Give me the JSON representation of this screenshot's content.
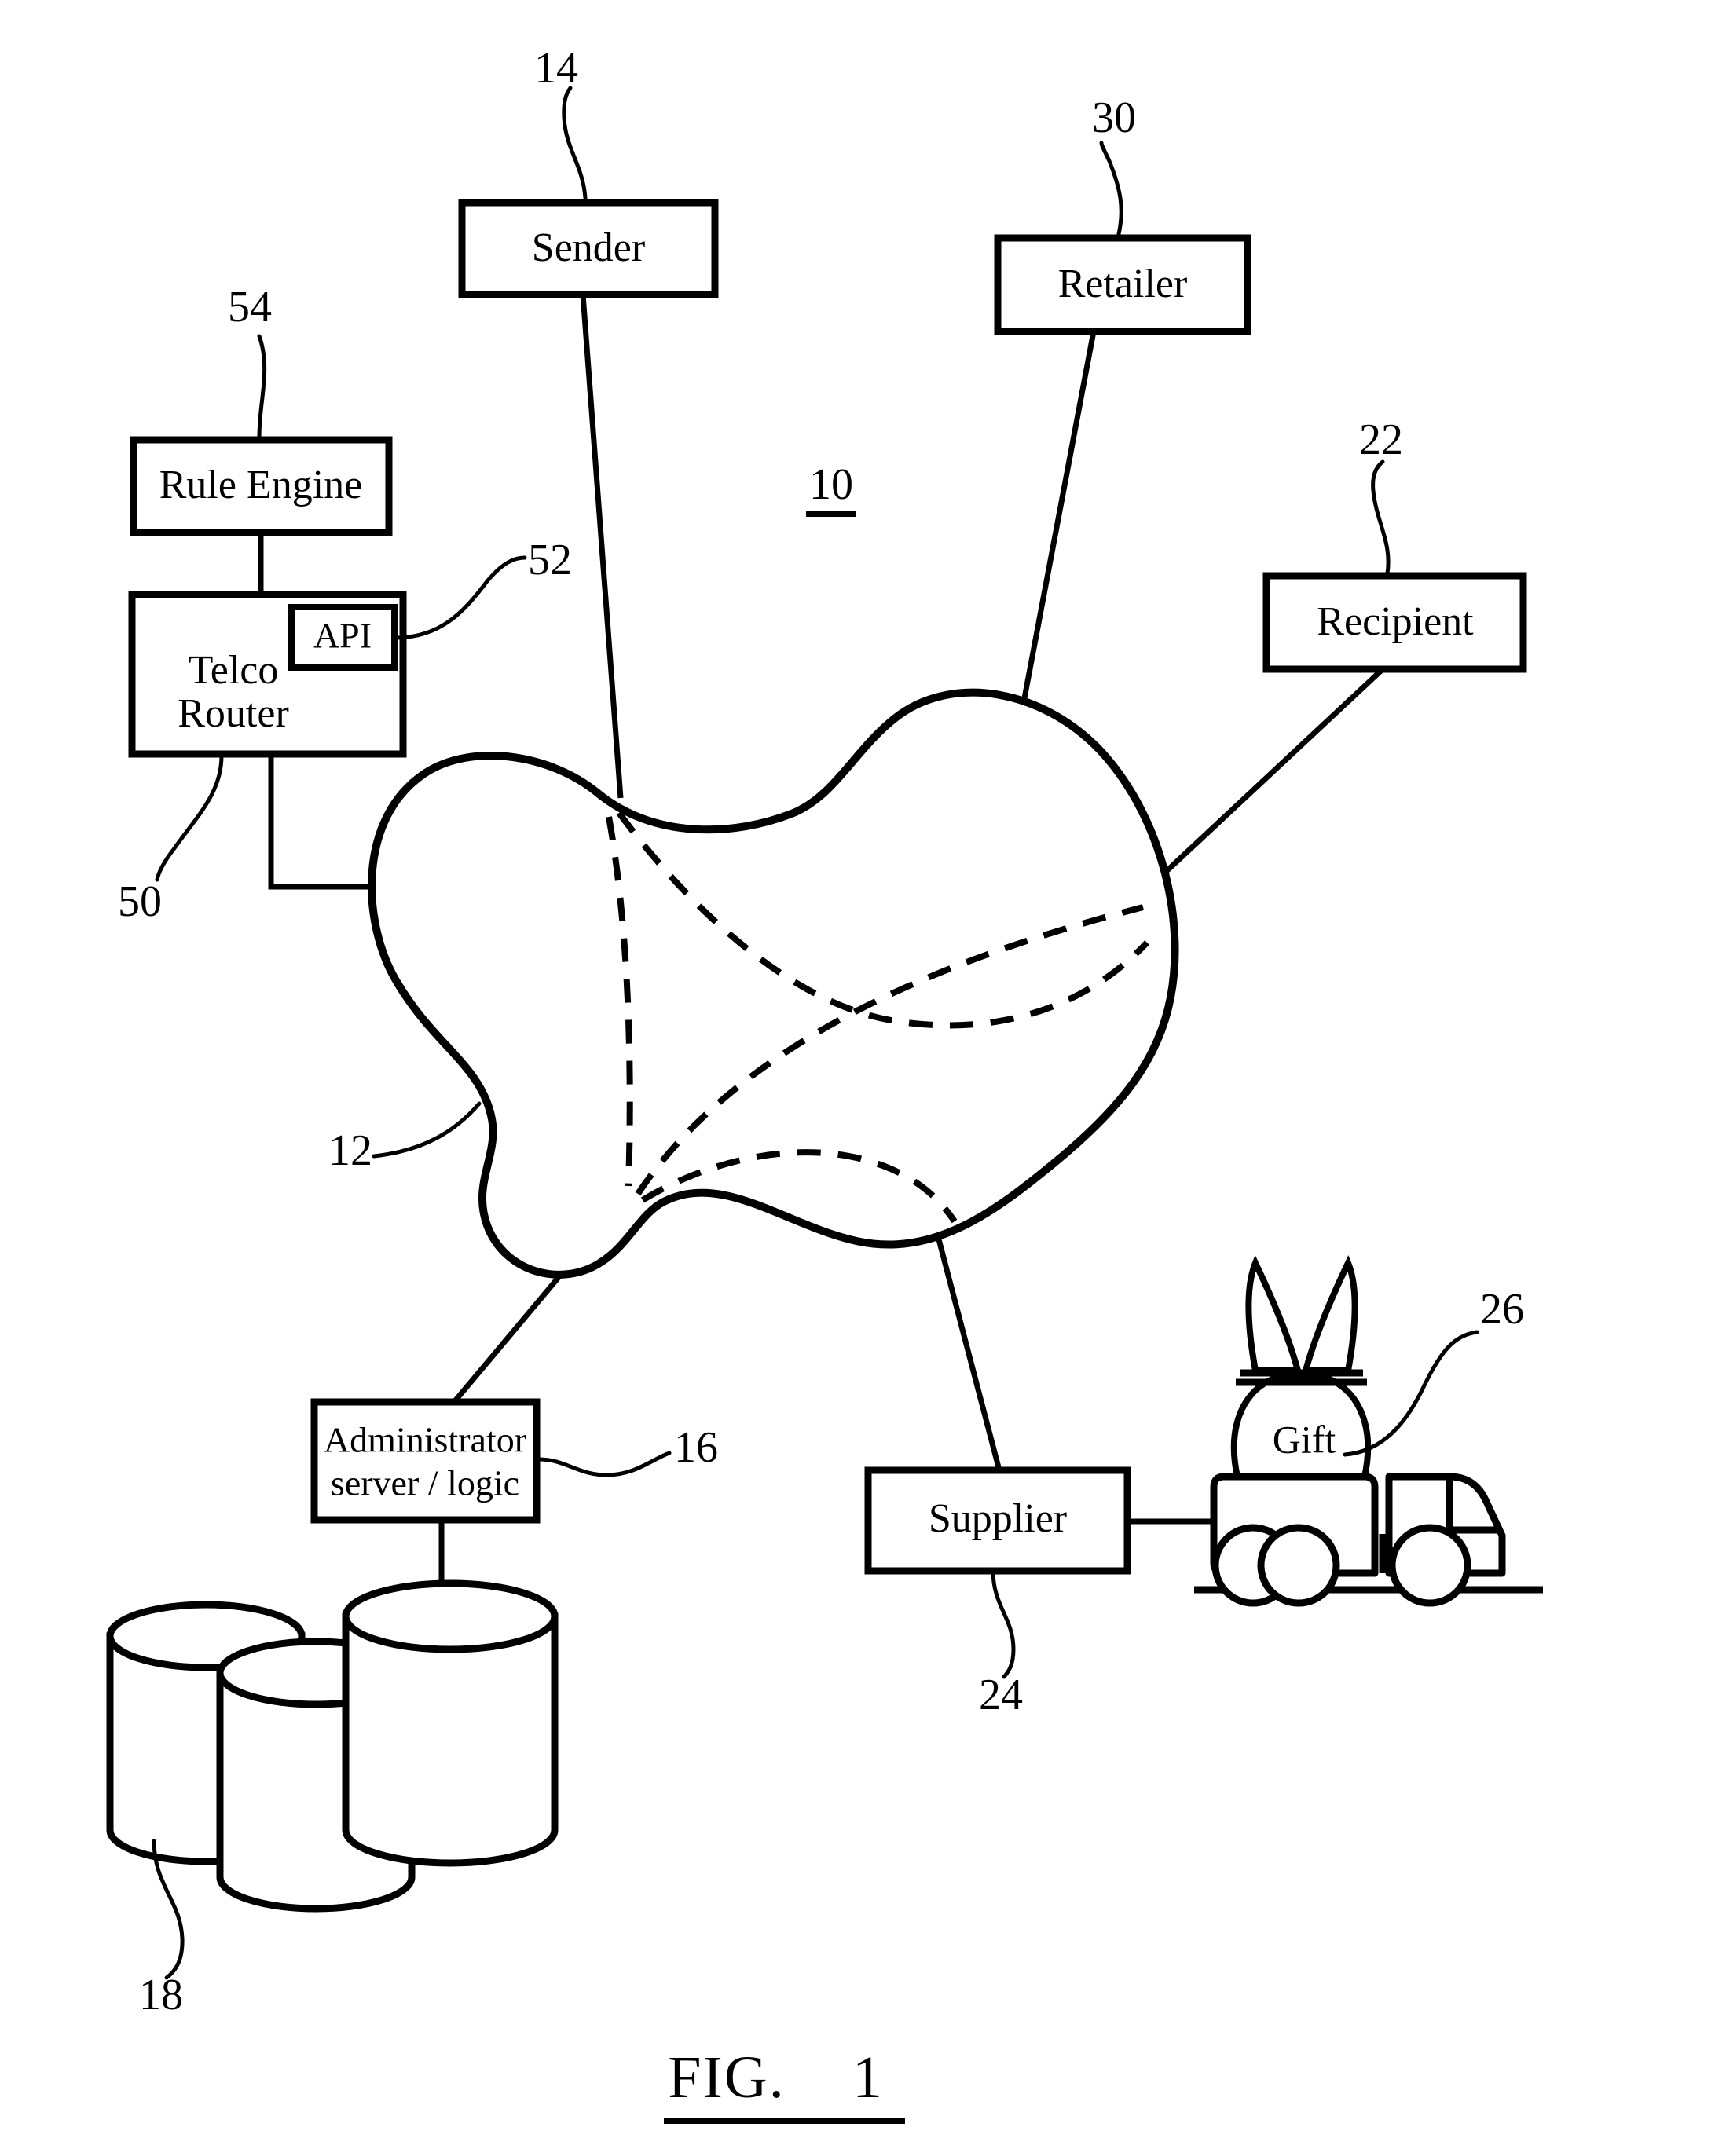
{
  "figure": {
    "caption_prefix": "FIG.",
    "caption_number": "1",
    "system_ref": "10"
  },
  "nodes": {
    "rule_engine": {
      "label": "Rule Engine",
      "ref": "54"
    },
    "telco_router": {
      "label_line1": "Telco",
      "label_line2": "Router",
      "ref": "50"
    },
    "api": {
      "label": "API",
      "ref": "52"
    },
    "sender": {
      "label": "Sender",
      "ref": "14"
    },
    "retailer": {
      "label": "Retailer",
      "ref": "30"
    },
    "recipient": {
      "label": "Recipient",
      "ref": "22"
    },
    "network": {
      "ref": "12"
    },
    "administrator": {
      "label_line1": "Administrator",
      "label_line2": "server / logic",
      "ref": "16"
    },
    "databases": {
      "ref": "18"
    },
    "supplier": {
      "label": "Supplier",
      "ref": "24"
    },
    "gift_delivery": {
      "label": "Gift",
      "ref": "26"
    }
  }
}
